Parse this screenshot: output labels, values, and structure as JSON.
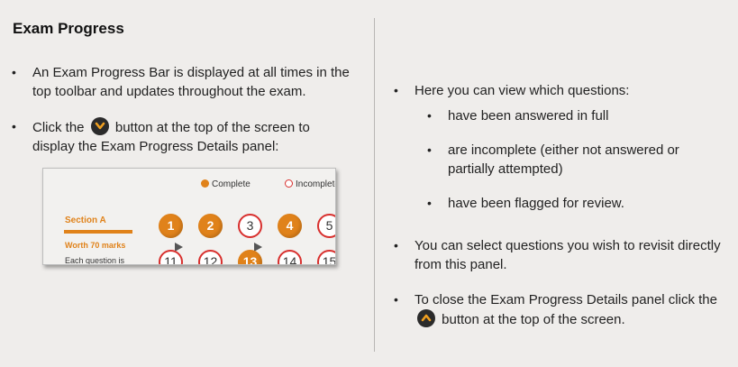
{
  "title": "Exam Progress",
  "left": {
    "bullet1": "An Exam Progress Bar is displayed at all times in the top toolbar and updates throughout the exam.",
    "bullet2_before": "Click the",
    "bullet2_after": "button at the top of the screen to display the Exam Progress Details panel:"
  },
  "inset": {
    "legend_complete": "Complete",
    "legend_incomplete": "Incomplete",
    "section_name": "Section A",
    "worth": "Worth 70 marks",
    "each_question": "Each question is",
    "row1": [
      "1",
      "2",
      "3",
      "4",
      "5"
    ],
    "row2": [
      "11",
      "12",
      "13",
      "14",
      "15"
    ]
  },
  "right": {
    "bullet1": "Here you can view which questions:",
    "sub1": "have been answered in full",
    "sub2": "are incomplete (either not answered or partially attempted)",
    "sub3": "have been flagged for review.",
    "bullet2": "You can select questions you wish to revisit directly from this panel.",
    "bullet3_before": "To close the Exam Progress Details panel click the",
    "bullet3_after": "button at the top of the screen."
  },
  "icons": {
    "expand": "chevron-down-icon",
    "collapse": "chevron-up-icon"
  },
  "colors": {
    "accent_orange": "#e0821a",
    "incomplete_red": "#d8302e",
    "button_dark": "#2b2b2b"
  }
}
